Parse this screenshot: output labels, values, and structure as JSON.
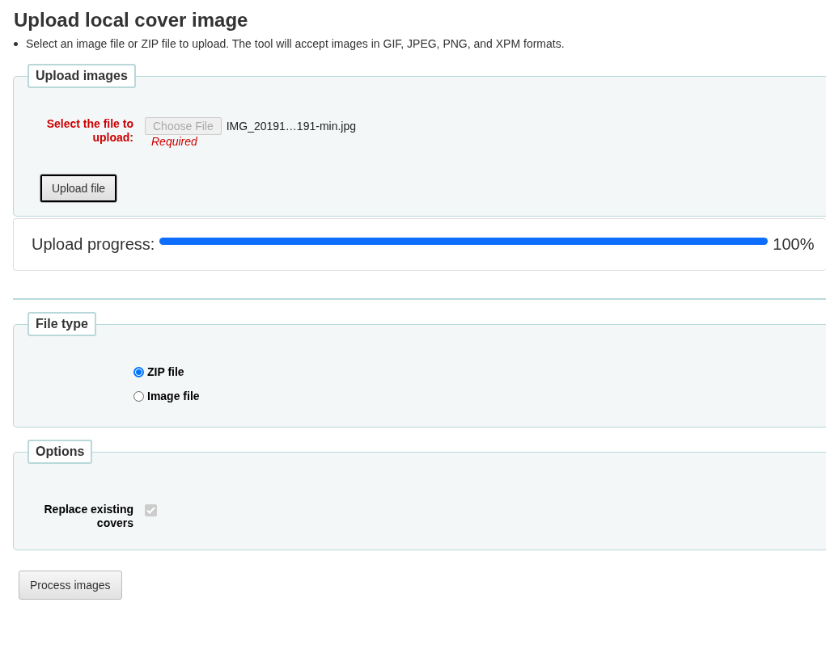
{
  "title": "Upload local cover image",
  "hint": "Select an image file or ZIP file to upload. The tool will accept images in GIF, JPEG, PNG, and XPM formats.",
  "upload_images": {
    "legend": "Upload images",
    "file_label": "Select the file to upload:",
    "choose_button": {
      "label": "Choose File",
      "disabled": true
    },
    "file_name": "IMG_20191…191-min.jpg",
    "required": "Required",
    "upload_button": {
      "label": "Upload file",
      "focused": true
    }
  },
  "progress": {
    "label": "Upload progress:",
    "level": 1,
    "reading": "100%"
  },
  "file_type": {
    "legend": "File type",
    "options": [
      {
        "label": "ZIP file",
        "selected": true
      },
      {
        "label": "Image file",
        "selected": false
      }
    ]
  },
  "options": {
    "legend": "Options",
    "items": [
      {
        "label": "Replace existing covers",
        "checked": true,
        "disabled": true
      }
    ]
  },
  "process_button": "Process images"
}
